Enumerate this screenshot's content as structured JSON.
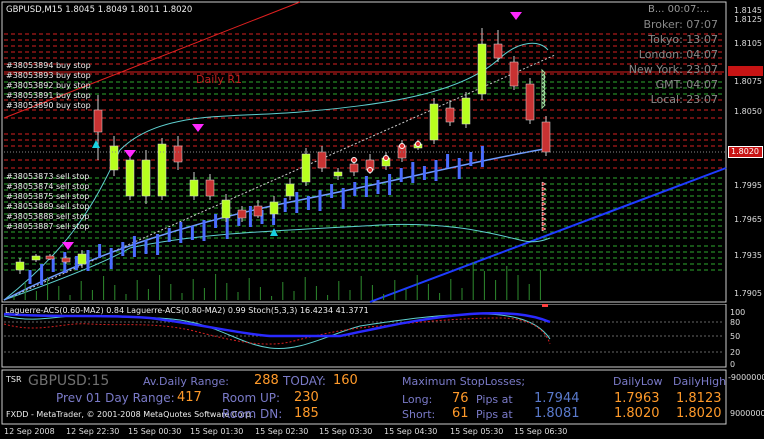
{
  "main_chart": {
    "header": "GBPUSD,M15  1.8045 1.8049 1.8011 1.8020",
    "daily_r1_label": "Daily R1",
    "current_price": "1.8020",
    "price_axis": {
      "top_label": "1.8145",
      "ticks": [
        "1.8125",
        "1.8105",
        "1.8075",
        "1.8050",
        "1.8020",
        "1.7995",
        "1.7965",
        "1.7935",
        "1.7905"
      ]
    },
    "order_labels": [
      "#38053894 buy stop",
      "#38053893 buy stop",
      "#38053892 buy stop",
      "#38053891 buy stop",
      "#38053890 buy stop",
      "#38053873 sell stop",
      "#38053874 sell stop",
      "#38053875 sell stop",
      "#38053889 sell stop",
      "#38053888 sell stop",
      "#38053887 sell stop"
    ],
    "session_times": [
      {
        "label": "Broker:",
        "value": "07:07"
      },
      {
        "label": "Tokyo:",
        "value": "13:07"
      },
      {
        "label": "London:",
        "value": "04:07"
      },
      {
        "label": "New York:",
        "value": "23:07"
      },
      {
        "label": "GMT:",
        "value": "04:07"
      },
      {
        "label": "Local:",
        "value": "23:07"
      }
    ],
    "session_header": "B... 00:07:..."
  },
  "indicator": {
    "header": "Laguerre-ACS(0.60-MA2) 0.84  Laguerre-ACS(0.80-MA2) 0.99  Stoch(5,3,3) 16.4234 41.3771",
    "ticks": [
      "100",
      "80",
      "50",
      "20",
      "0"
    ]
  },
  "stats": {
    "tsr_label": "TSR",
    "symbol": "GBPUSD:15",
    "footer": "FXDD - MetaTrader, © 2001-2008 MetaQuotes Software Corp.",
    "avg_daily_range_label": "Av.Daily Range:",
    "avg_daily_range": "288",
    "today_label": "TODAY:",
    "today": "160",
    "prev_range_label": "Prev 01 Day Range:",
    "prev_range": "417",
    "room_up_label": "Room UP:",
    "room_up": "230",
    "room_dn_label": "Room DN:",
    "room_dn": "185",
    "max_sl_label": "Maximum StopLosses;",
    "long_label": "Long:",
    "long_pips": "76",
    "long_at": "Pips at",
    "long_price": "1.7944",
    "short_label": "Short:",
    "short_pips": "61",
    "short_at": "Pips at",
    "short_price": "1.8081",
    "daily_low_label": "DailyLow",
    "daily_high_label": "DailyHigh",
    "long_low": "1.7963",
    "long_high": "1.8123",
    "short_low": "1.8020",
    "short_high": "1.8020",
    "right_axis_top": "-9000000",
    "right_axis_bottom": "9000000"
  },
  "time_axis": [
    "12 Sep 2008",
    "12 Sep 22:30",
    "15 Sep 00:30",
    "15 Sep 01:30",
    "15 Sep 02:30",
    "15 Sep 03:30",
    "15 Sep 04:30",
    "15 Sep 05:30",
    "15 Sep 06:30"
  ],
  "colors": {
    "bull": "#b8ff1e",
    "bear": "#c83232",
    "resistance": "#d42020",
    "support": "#2ea82e",
    "price_marker": "#c81414"
  }
}
